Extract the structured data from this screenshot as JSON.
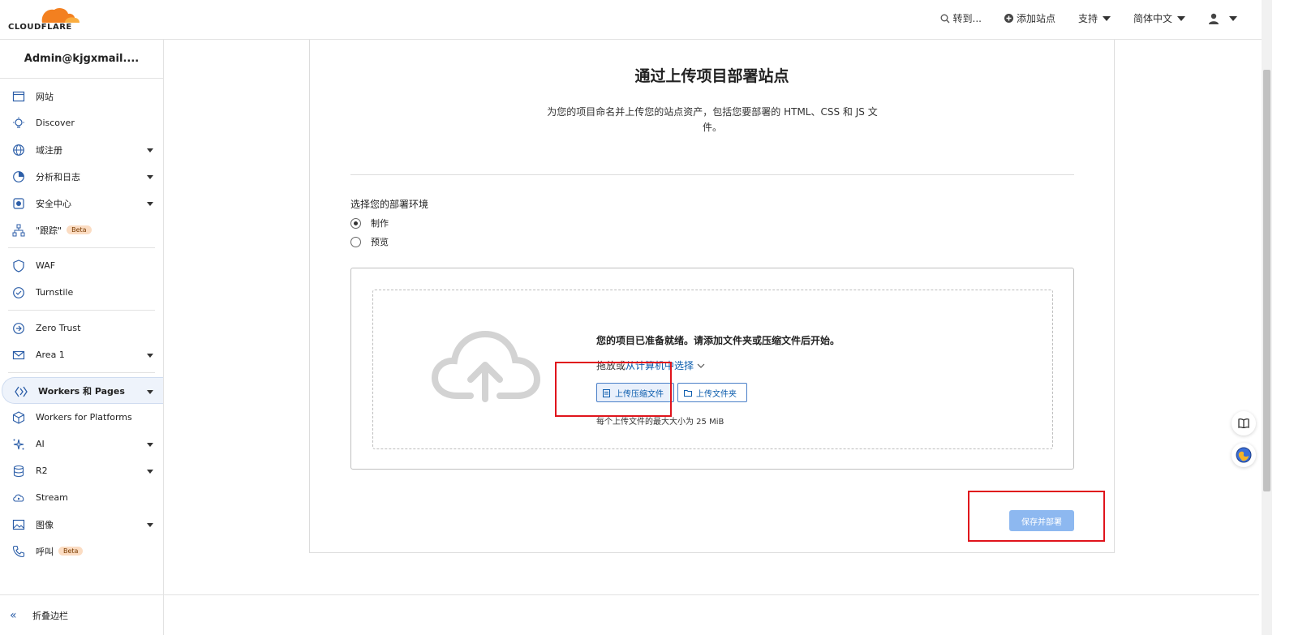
{
  "header": {
    "logo_text": "CLOUDFLARE",
    "goto_label": "转到...",
    "add_site_label": "添加站点",
    "support_label": "支持",
    "language_label": "简体中文"
  },
  "sidebar": {
    "account": "Admin@kjgxmail....",
    "items": [
      {
        "label": "网站",
        "icon": "browser-window-icon"
      },
      {
        "label": "Discover",
        "icon": "lightbulb-icon"
      },
      {
        "label": "域注册",
        "icon": "globe-icon"
      },
      {
        "label": "分析和日志",
        "icon": "chart-clock-icon"
      },
      {
        "label": "安全中心",
        "icon": "security-center-icon"
      },
      {
        "label": "\"跟踪\"",
        "icon": "trace-icon",
        "badge": "Beta"
      },
      {
        "label": "WAF",
        "icon": "shield-icon"
      },
      {
        "label": "Turnstile",
        "icon": "turnstile-icon"
      },
      {
        "label": "Zero Trust",
        "icon": "zero-trust-icon"
      },
      {
        "label": "Area 1",
        "icon": "mail-icon"
      },
      {
        "label": "Workers 和 Pages",
        "icon": "workers-icon"
      },
      {
        "label": "Workers for Platforms",
        "icon": "cube-icon"
      },
      {
        "label": "AI",
        "icon": "sparkle-icon"
      },
      {
        "label": "R2",
        "icon": "database-icon"
      },
      {
        "label": "Stream",
        "icon": "cloud-play-icon"
      },
      {
        "label": "图像",
        "icon": "image-icon"
      },
      {
        "label": "呼叫",
        "icon": "phone-icon",
        "badge": "Beta"
      }
    ],
    "collapse_label": "折叠边栏"
  },
  "main": {
    "title": "通过上传项目部署站点",
    "description": "为您的项目命名并上传您的站点资产，包括您要部署的 HTML、CSS 和 JS 文件。",
    "env_label": "选择您的部署环境",
    "env_options": [
      "制作",
      "预览"
    ],
    "env_selected": "制作",
    "upload": {
      "ready_text": "您的项目已准备就绪。请添加文件夹或压缩文件后开始。",
      "drag_prefix": "拖放或",
      "drag_link": "从计算机中选择",
      "zip_button": "上传压缩文件",
      "folder_button": "上传文件夹",
      "max_size": "每个上传文件的最大大小为 25 MiB"
    },
    "deploy_button": "保存并部署"
  },
  "colors": {
    "accent": "#0b5cad",
    "brand_orange": "#f38020",
    "highlight_red": "#e0141c",
    "deploy_disabled": "#8db8f0"
  }
}
